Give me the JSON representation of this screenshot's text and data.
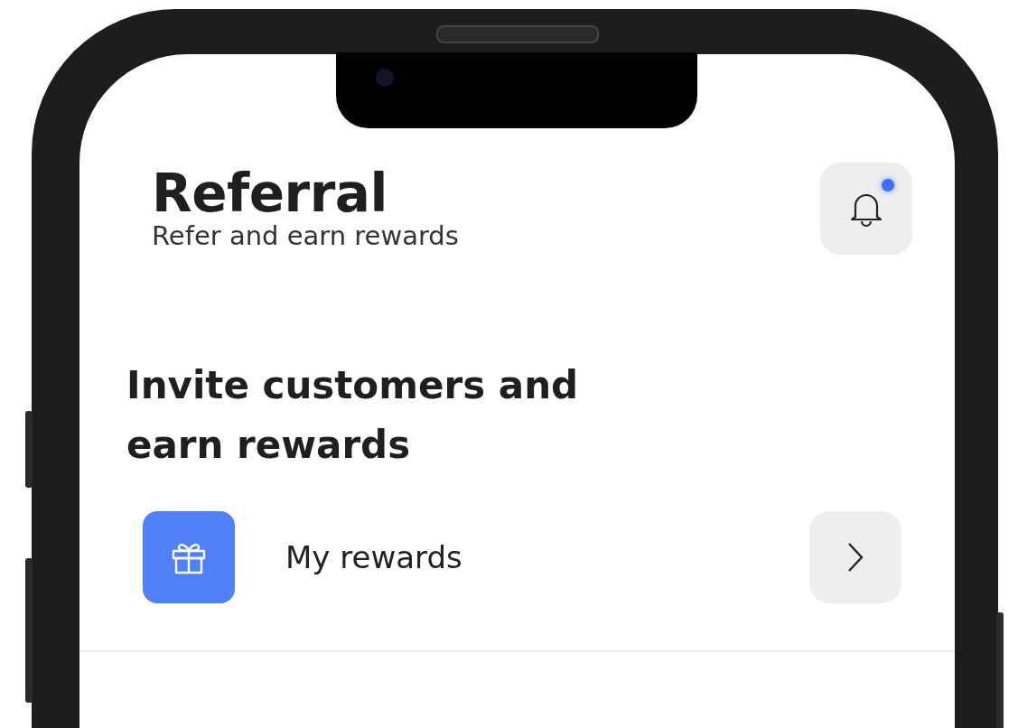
{
  "header": {
    "title": "Referral",
    "subtitle": "Refer and earn rewards",
    "notifications": {
      "unread": true
    }
  },
  "section": {
    "heading": "Invite customers and earn rewards"
  },
  "menu_items": [
    {
      "label": "My rewards",
      "kind": "gift"
    }
  ]
}
